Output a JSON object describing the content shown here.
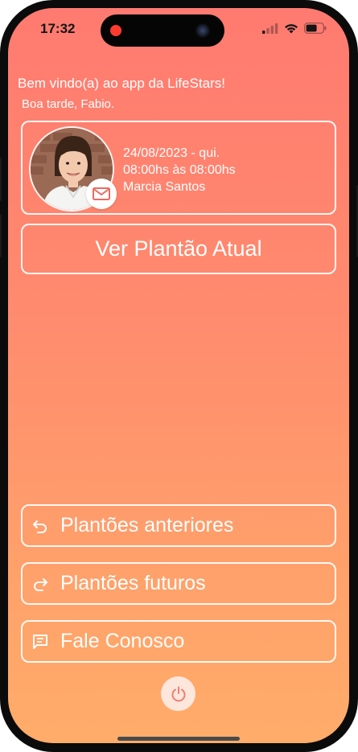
{
  "status_bar": {
    "time": "17:32"
  },
  "header": {
    "welcome": "Bem vindo(a) ao app da LifeStars!",
    "greeting": "Boa tarde, Fabio."
  },
  "shift_card": {
    "date": "24/08/2023 - qui.",
    "hours": "08:00hs às 08:00hs",
    "professional": "Marcia Santos",
    "avatar_icon": "person-photo",
    "badge_icon": "mail-icon"
  },
  "actions": {
    "current_shift": "Ver Plantão Atual",
    "previous_shifts": "Plantões anteriores",
    "future_shifts": "Plantões futuros",
    "contact": "Fale Conosco"
  },
  "icons": {
    "previous": "undo-arrow-icon",
    "future": "redo-arrow-icon",
    "contact": "chat-icon",
    "power": "power-icon"
  },
  "colors": {
    "gradient_top": "#ff7a70",
    "gradient_bottom": "#ffac6a",
    "accent": "#ffffff",
    "power_bg": "#fde6dc",
    "power_icon": "#f07e6e"
  }
}
